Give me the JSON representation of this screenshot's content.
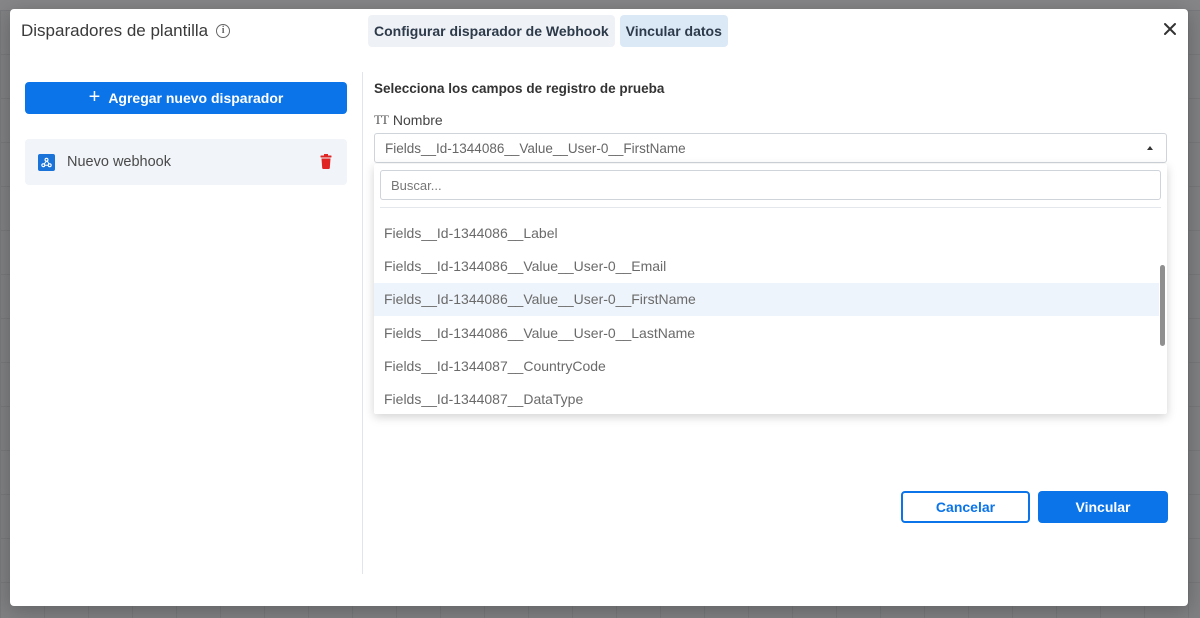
{
  "modal": {
    "title": "Disparadores de plantilla",
    "tabs": [
      {
        "label": "Configurar disparador de Webhook",
        "active": false
      },
      {
        "label": "Vincular datos",
        "active": true
      }
    ]
  },
  "left_panel": {
    "add_button_label": "Agregar nuevo disparador",
    "triggers": [
      {
        "label": "Nuevo webhook",
        "icon": "webhook-icon"
      }
    ]
  },
  "mapping": {
    "section_title": "Selecciona los campos de registro de prueba",
    "field_label": "Nombre",
    "selected_value": "Fields__Id-1344086__Value__User-0__FirstName",
    "search_placeholder": "Buscar...",
    "options": [
      {
        "label": "Fields__Id-1344086__Label",
        "selected": false
      },
      {
        "label": "Fields__Id-1344086__Value__User-0__Email",
        "selected": false
      },
      {
        "label": "Fields__Id-1344086__Value__User-0__FirstName",
        "selected": true
      },
      {
        "label": "Fields__Id-1344086__Value__User-0__LastName",
        "selected": false
      },
      {
        "label": "Fields__Id-1344087__CountryCode",
        "selected": false
      },
      {
        "label": "Fields__Id-1344087__DataType",
        "selected": false
      }
    ]
  },
  "footer": {
    "cancel_label": "Cancelar",
    "link_label": "Vincular"
  },
  "colors": {
    "primary": "#0a74e8",
    "delete": "#e02424",
    "active_tab": "#dbe9f7"
  }
}
